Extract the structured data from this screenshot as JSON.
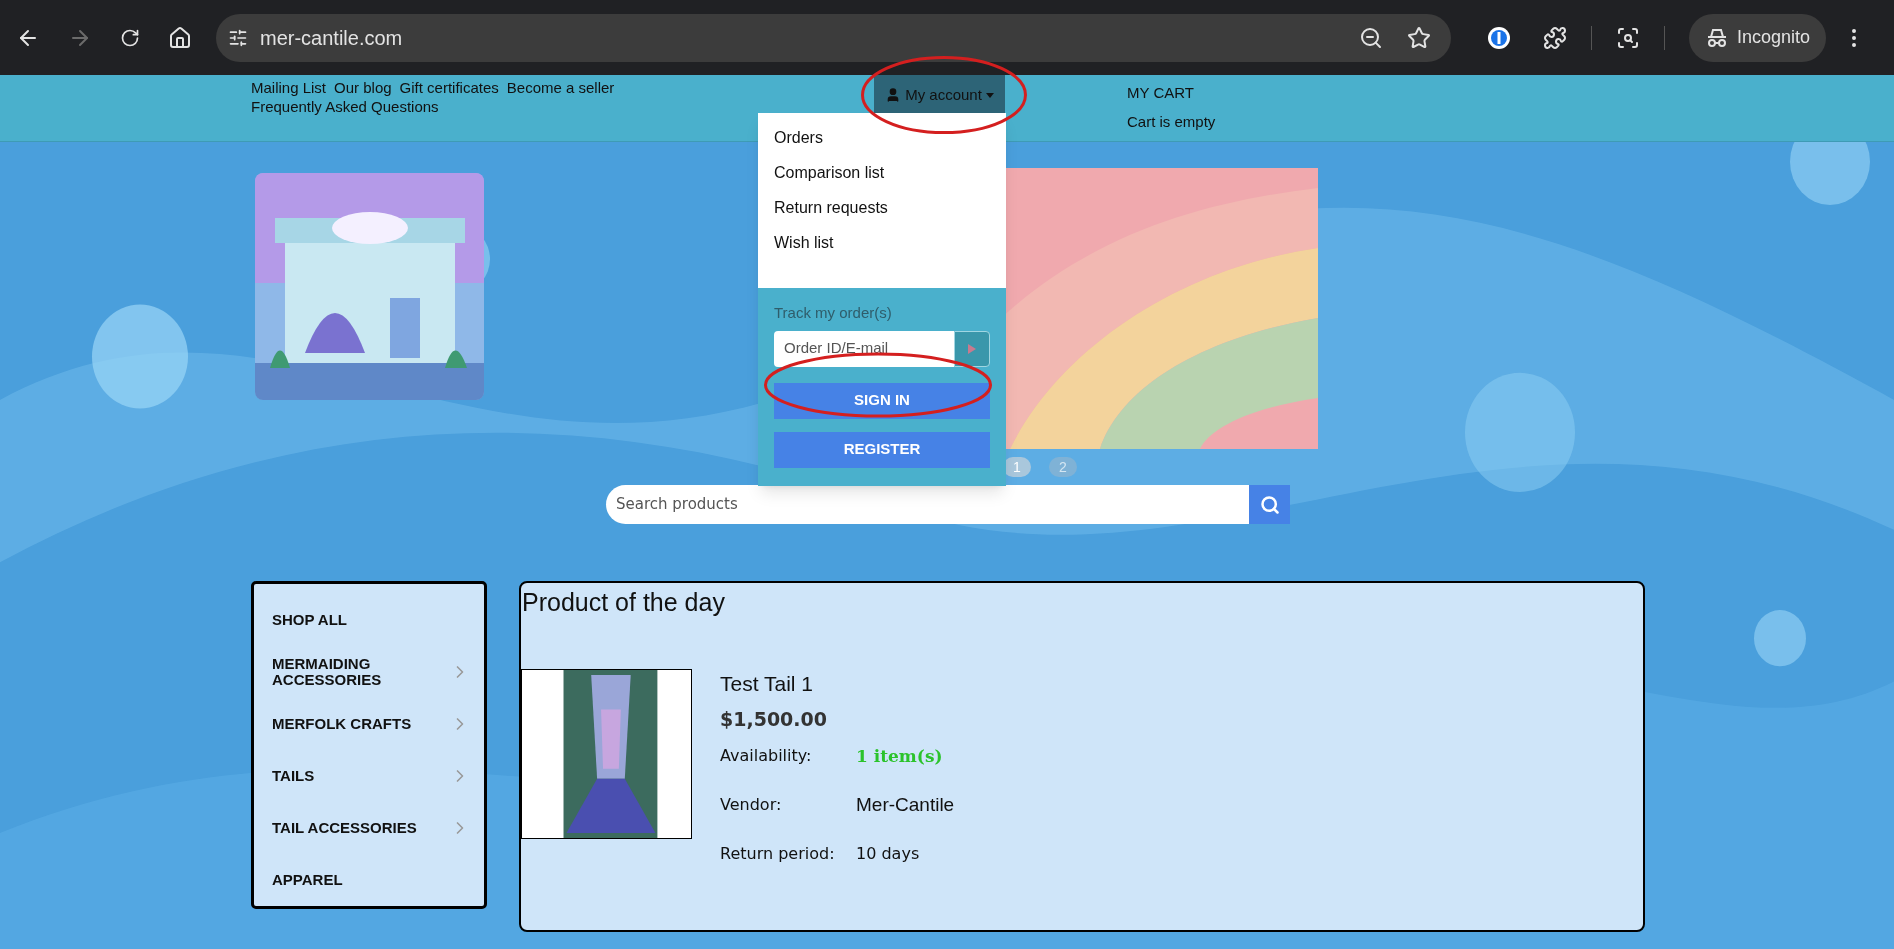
{
  "browser": {
    "url": "mer-cantile.com",
    "forward_disabled": true,
    "profile": "Incognito"
  },
  "top_links": [
    {
      "label": "Mailing List"
    },
    {
      "label": "Our blog"
    },
    {
      "label": "Gift certificates"
    },
    {
      "label": "Become a seller"
    },
    {
      "label": "Frequently Asked Questions"
    }
  ],
  "account_menu": {
    "label": "My account",
    "expanded": true,
    "items": [
      {
        "label": "Orders"
      },
      {
        "label": "Comparison list"
      },
      {
        "label": "Return requests"
      },
      {
        "label": "Wish list"
      }
    ],
    "track_label": "Track my order(s)",
    "track_placeholder": "Order ID/E-mail",
    "buttons": [
      {
        "label": "SIGN IN"
      },
      {
        "label": "REGISTER"
      }
    ]
  },
  "cart": {
    "title": "MY CART",
    "status": "Cart is empty"
  },
  "carousel": {
    "pages": [
      {
        "label": "1",
        "selected": true
      },
      {
        "label": "2",
        "selected": false
      }
    ]
  },
  "search": {
    "placeholder": "Search products"
  },
  "categories": [
    {
      "label": "SHOP ALL",
      "has_children": false
    },
    {
      "label": "MERMAIDING ACCESSORIES",
      "has_children": true
    },
    {
      "label": "MERFOLK CRAFTS",
      "has_children": true
    },
    {
      "label": "TAILS",
      "has_children": true
    },
    {
      "label": "TAIL ACCESSORIES",
      "has_children": true
    },
    {
      "label": "APPAREL",
      "has_children": false
    }
  ],
  "product_of_the_day": {
    "heading": "Product of the day",
    "name": "Test Tail 1",
    "price": "$1,500.00",
    "fields": [
      {
        "kind": "stock",
        "label": "Availability:",
        "value": "1 item(s)"
      },
      {
        "kind": "vendor",
        "label": "Vendor:",
        "value": "Mer-Cantile"
      },
      {
        "kind": "plain",
        "label": "Return period:",
        "value": "10 days"
      }
    ]
  }
}
